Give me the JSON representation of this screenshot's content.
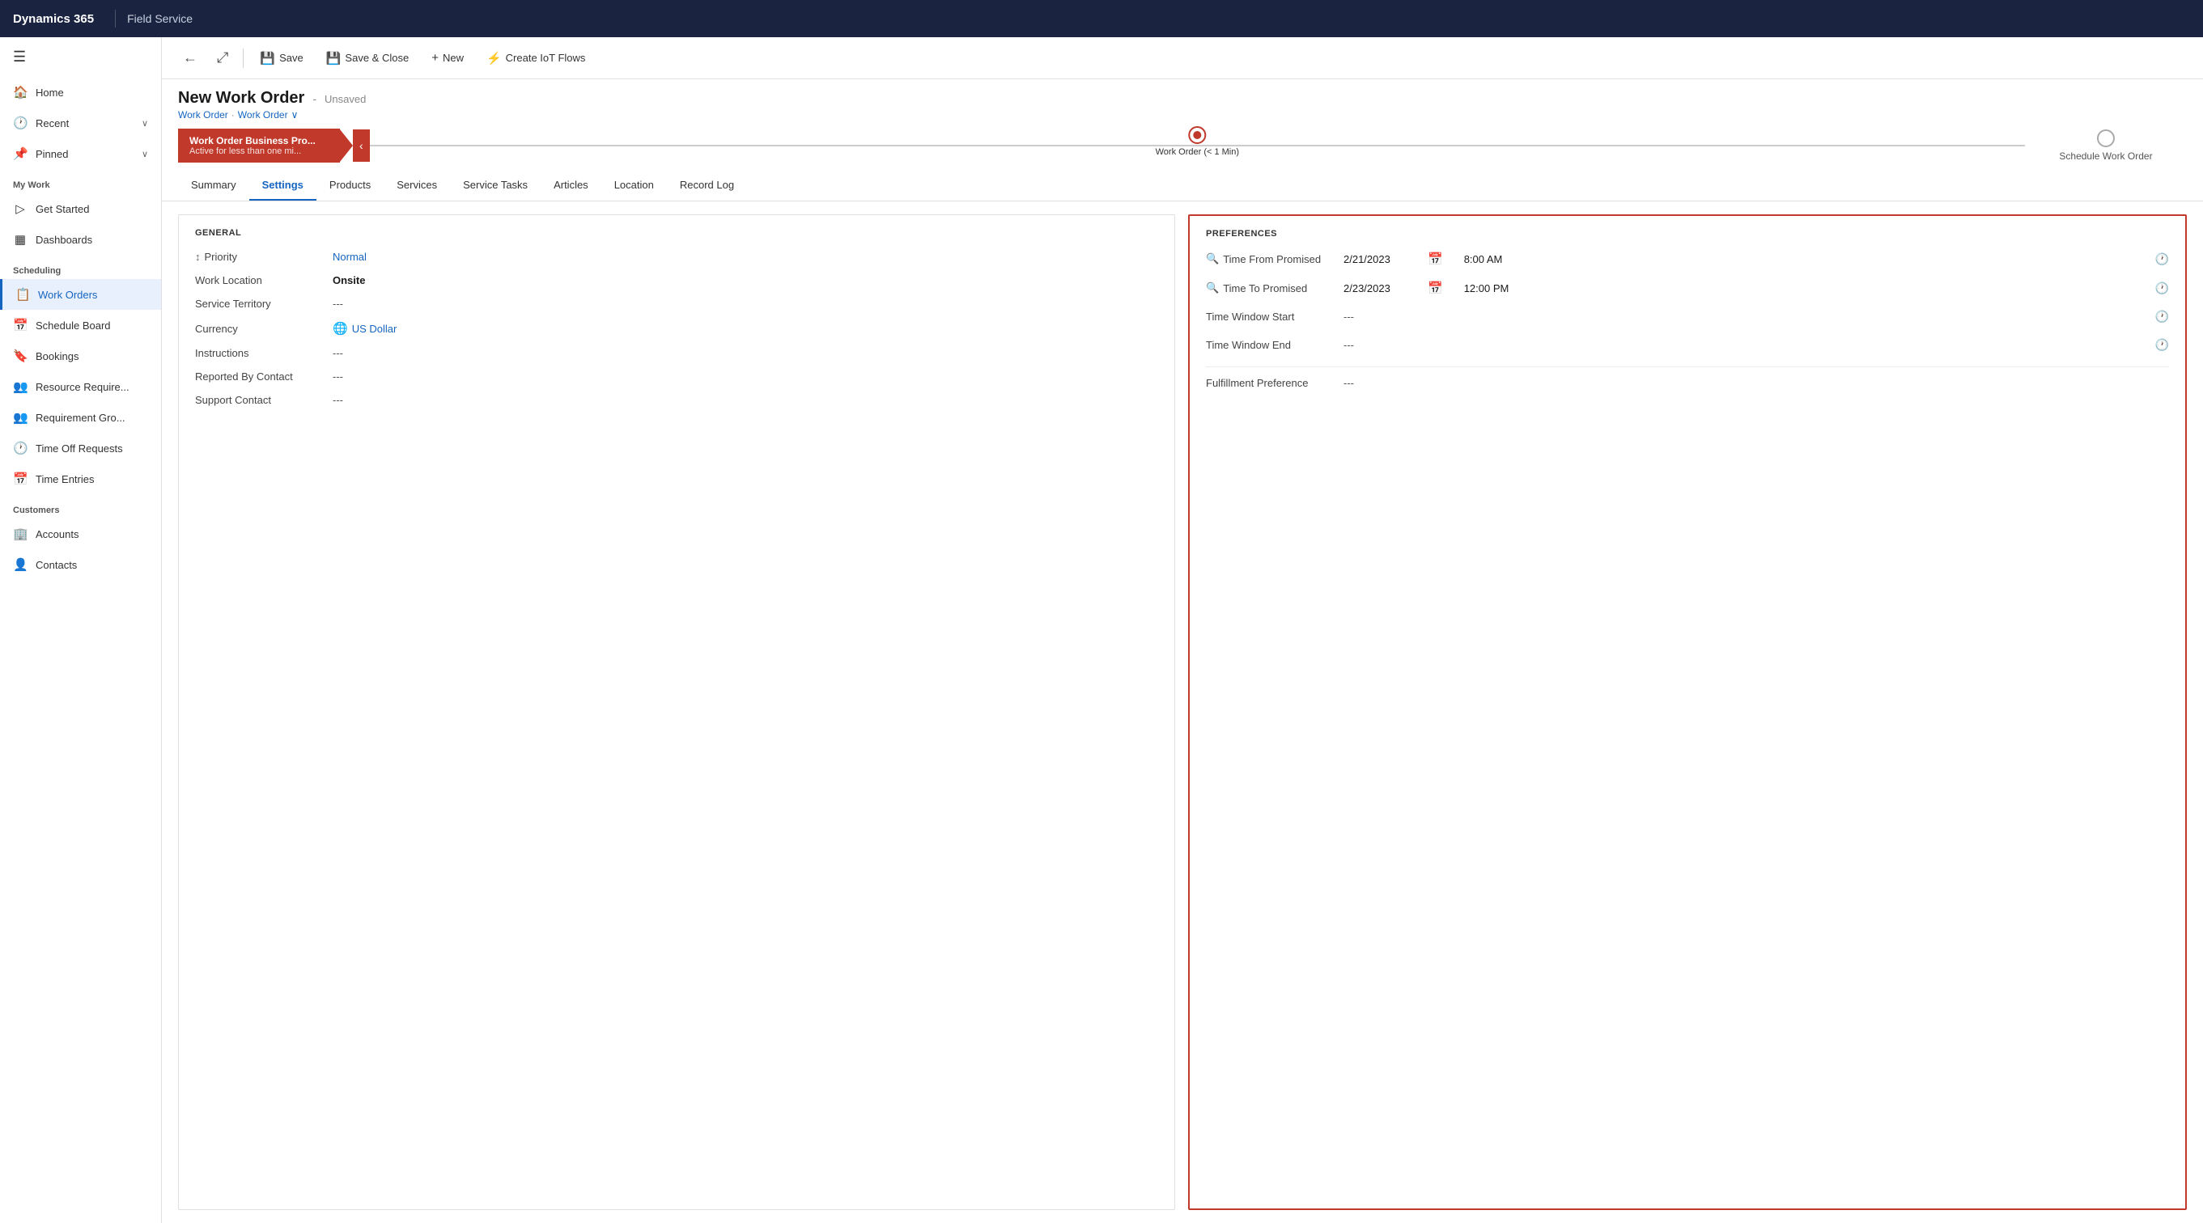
{
  "topBar": {
    "appName": "Dynamics 365",
    "divider": "|",
    "moduleName": "Field Service"
  },
  "commandBar": {
    "backLabel": "←",
    "popoutLabel": "⤢",
    "saveLabel": "Save",
    "saveCloseLabel": "Save & Close",
    "newLabel": "New",
    "createIotLabel": "Create IoT Flows",
    "saveIcon": "💾",
    "saveCloseIcon": "💾",
    "newIcon": "+",
    "iotIcon": "⚡"
  },
  "pageHeader": {
    "title": "New Work Order",
    "status": "Unsaved",
    "breadcrumb1": "Work Order",
    "breadcrumb2": "Work Order",
    "breadcrumbChevron": "∨"
  },
  "progressBar": {
    "stage1Title": "Work Order Business Pro...",
    "stage1Sub": "Active for less than one mi...",
    "stage1Active": true,
    "stage2Label": "Work Order (< 1 Min)",
    "stage3Label": "Schedule Work Order"
  },
  "tabs": [
    {
      "id": "summary",
      "label": "Summary",
      "active": false
    },
    {
      "id": "settings",
      "label": "Settings",
      "active": true
    },
    {
      "id": "products",
      "label": "Products",
      "active": false
    },
    {
      "id": "services",
      "label": "Services",
      "active": false
    },
    {
      "id": "service-tasks",
      "label": "Service Tasks",
      "active": false
    },
    {
      "id": "articles",
      "label": "Articles",
      "active": false
    },
    {
      "id": "location",
      "label": "Location",
      "active": false
    },
    {
      "id": "record-log",
      "label": "Record Log",
      "active": false
    }
  ],
  "general": {
    "sectionTitle": "GENERAL",
    "fields": [
      {
        "id": "priority",
        "label": "Priority",
        "hasIcon": true,
        "value": "Normal",
        "type": "link",
        "bold": false
      },
      {
        "id": "work-location",
        "label": "Work Location",
        "hasIcon": false,
        "value": "Onsite",
        "type": "bold",
        "bold": true
      },
      {
        "id": "service-territory",
        "label": "Service Territory",
        "hasIcon": false,
        "value": "---",
        "type": "empty"
      },
      {
        "id": "currency",
        "label": "Currency",
        "hasIcon": false,
        "value": "US Dollar",
        "type": "link",
        "hasCurrencyIcon": true
      },
      {
        "id": "instructions",
        "label": "Instructions",
        "hasIcon": false,
        "value": "---",
        "type": "empty"
      },
      {
        "id": "reported-by-contact",
        "label": "Reported By Contact",
        "hasIcon": false,
        "value": "---",
        "type": "empty"
      },
      {
        "id": "support-contact",
        "label": "Support Contact",
        "hasIcon": false,
        "value": "---",
        "type": "empty"
      }
    ]
  },
  "preferences": {
    "sectionTitle": "PREFERENCES",
    "fields": [
      {
        "id": "time-from-promised",
        "label": "Time From Promised",
        "hasIcon": true,
        "date": "2/21/2023",
        "time": "8:00 AM",
        "hasDatePicker": true,
        "hasTimePicker": true
      },
      {
        "id": "time-to-promised",
        "label": "Time To Promised",
        "hasIcon": true,
        "date": "2/23/2023",
        "time": "12:00 PM",
        "hasDatePicker": true,
        "hasTimePicker": true
      },
      {
        "id": "time-window-start",
        "label": "Time Window Start",
        "hasIcon": false,
        "date": "",
        "time": "",
        "empty": "---",
        "hasDatePicker": false,
        "hasTimePicker": true
      },
      {
        "id": "time-window-end",
        "label": "Time Window End",
        "hasIcon": false,
        "date": "",
        "time": "",
        "empty": "---",
        "hasDatePicker": false,
        "hasTimePicker": true
      }
    ],
    "fulfillmentLabel": "Fulfillment Preference",
    "fulfillmentValue": "---"
  },
  "sidebar": {
    "hamburgerIcon": "☰",
    "navItems": [
      {
        "id": "home",
        "icon": "🏠",
        "label": "Home",
        "active": false,
        "hasChevron": false
      },
      {
        "id": "recent",
        "icon": "🕐",
        "label": "Recent",
        "active": false,
        "hasChevron": true
      },
      {
        "id": "pinned",
        "icon": "📌",
        "label": "Pinned",
        "active": false,
        "hasChevron": true
      }
    ],
    "myWorkLabel": "My Work",
    "myWorkItems": [
      {
        "id": "get-started",
        "icon": "▷",
        "label": "Get Started",
        "active": false
      },
      {
        "id": "dashboards",
        "icon": "▦",
        "label": "Dashboards",
        "active": false
      }
    ],
    "schedulingLabel": "Scheduling",
    "schedulingItems": [
      {
        "id": "work-orders",
        "icon": "📋",
        "label": "Work Orders",
        "active": true
      },
      {
        "id": "schedule-board",
        "icon": "📅",
        "label": "Schedule Board",
        "active": false
      },
      {
        "id": "bookings",
        "icon": "🔖",
        "label": "Bookings",
        "active": false
      },
      {
        "id": "resource-req",
        "icon": "👥",
        "label": "Resource Require...",
        "active": false
      },
      {
        "id": "requirement-gro",
        "icon": "👥",
        "label": "Requirement Gro...",
        "active": false
      },
      {
        "id": "time-off",
        "icon": "🕐",
        "label": "Time Off Requests",
        "active": false
      },
      {
        "id": "time-entries",
        "icon": "📅",
        "label": "Time Entries",
        "active": false
      }
    ],
    "customersLabel": "Customers",
    "customersItems": [
      {
        "id": "accounts",
        "icon": "🏢",
        "label": "Accounts",
        "active": false
      },
      {
        "id": "contacts",
        "icon": "👤",
        "label": "Contacts",
        "active": false
      }
    ]
  }
}
